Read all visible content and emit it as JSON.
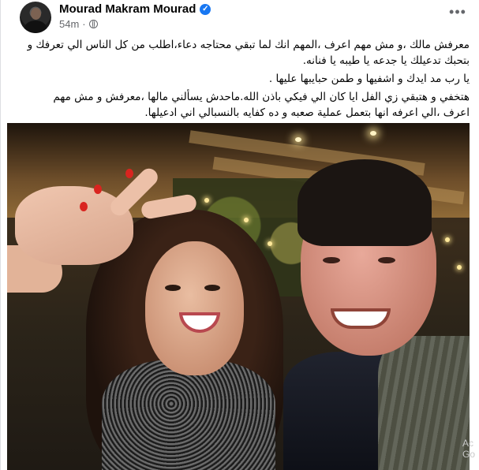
{
  "post": {
    "author": "Mourad Makram Mourad",
    "verified": true,
    "timestamp": "54m",
    "privacy_icon": "globe-icon",
    "more_icon": "more-options-icon",
    "text_paragraphs": [
      "معرفش مالك ،و مش مهم اعرف ،المهم انك لما تبقي محتاجه دعاء،اطلب من كل الناس الي تعرفك و بتحبك تدعيلك يا جدعه يا طيبه يا فنانه.",
      "يا رب مد ايدك و اشفيها و طمن حبايبها عليها .",
      "هتخفي و هتبقي زي الفل ايا كان الي فيكي باذن الله.ماحدش يسألني مالها ،معرفش و مش مهم اعرف ،الي اعرفه انها بتعمل عملية صعبه و ده كفايه بالنسبالي اني ادعيلها."
    ],
    "photo_alt": "selfie-photo",
    "watermark": "Ac\nGo"
  },
  "colors": {
    "verified_blue": "#1877f2",
    "meta_gray": "#65676b",
    "text": "#050505"
  }
}
